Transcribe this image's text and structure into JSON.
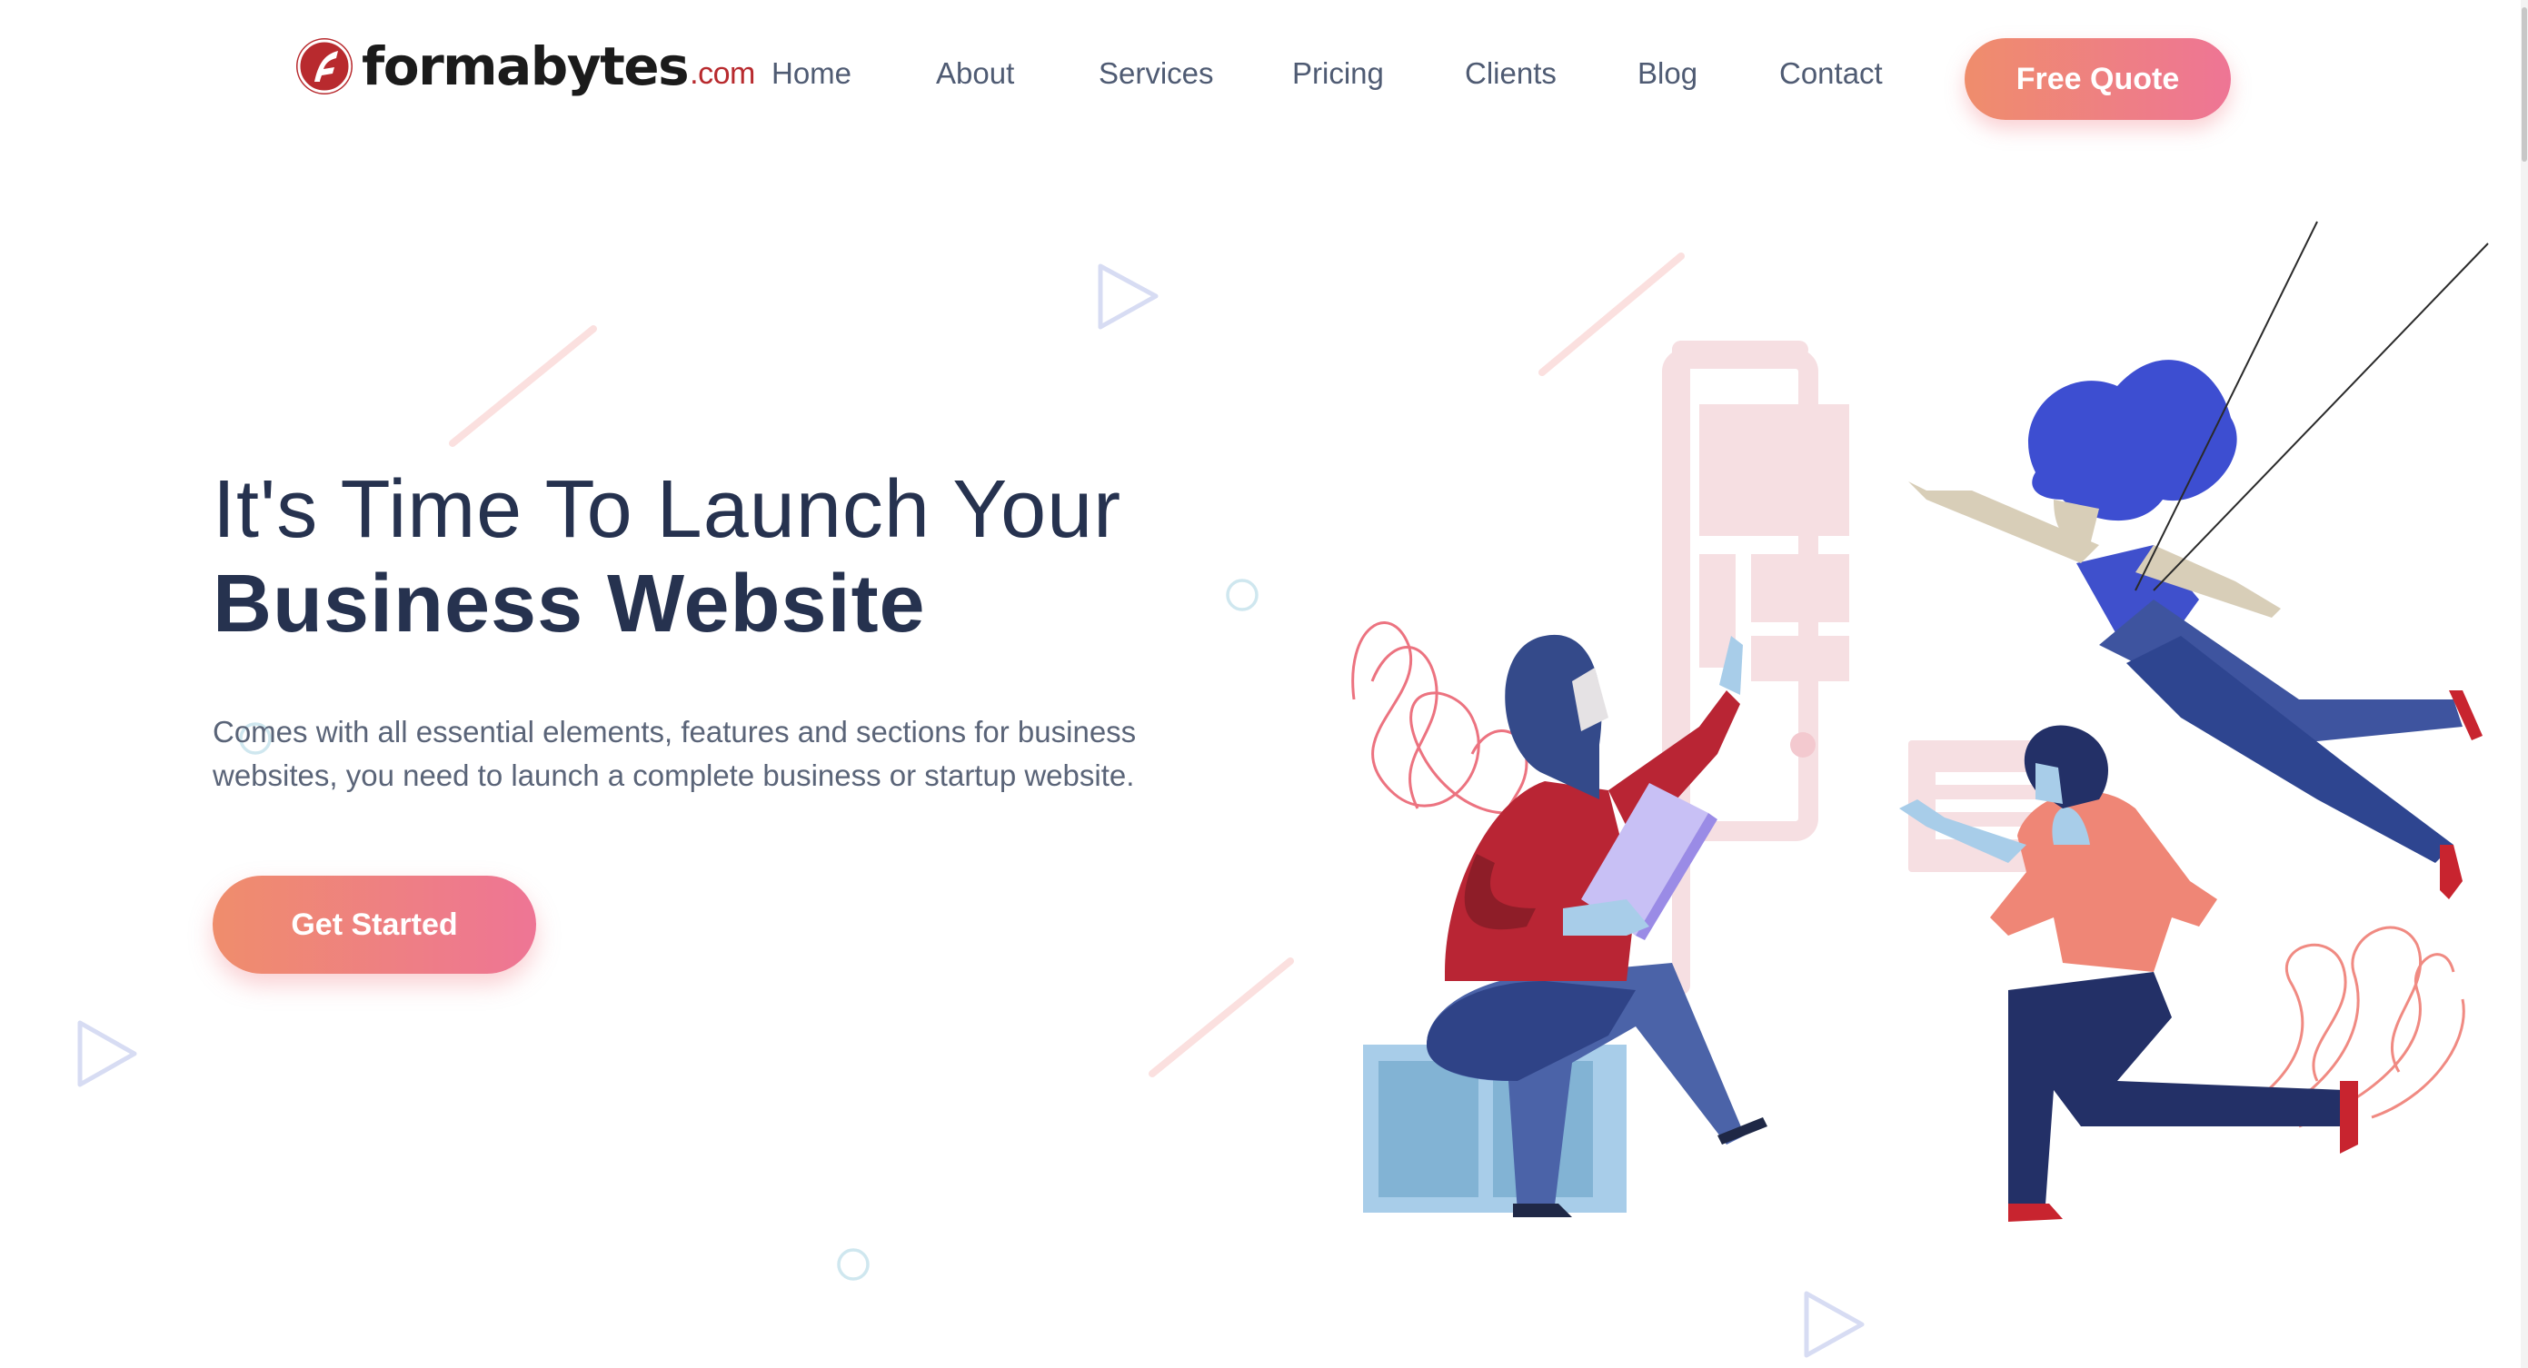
{
  "brand": {
    "name": "formabytes",
    "tld": ".com",
    "color": "#b82a2e"
  },
  "nav": {
    "items": [
      "Home",
      "About",
      "Services",
      "Pricing",
      "Clients",
      "Blog",
      "Contact"
    ],
    "cta_label": "Free Quote"
  },
  "hero": {
    "title_line1": "It's Time To Launch Your",
    "title_line2": "Business Website",
    "description": "Comes with all essential elements, features and sections for business websites, you need to launch a complete business or startup website.",
    "button_label": "Get Started"
  },
  "colors": {
    "gradient_start": "#ef8d6c",
    "gradient_end": "#ee7595",
    "heading": "#26324f",
    "body_text": "#5a6478",
    "nav_text": "#4f5b73"
  },
  "icons": [
    "logo-f-icon",
    "triangle-outline-icon",
    "circle-outline-icon"
  ]
}
